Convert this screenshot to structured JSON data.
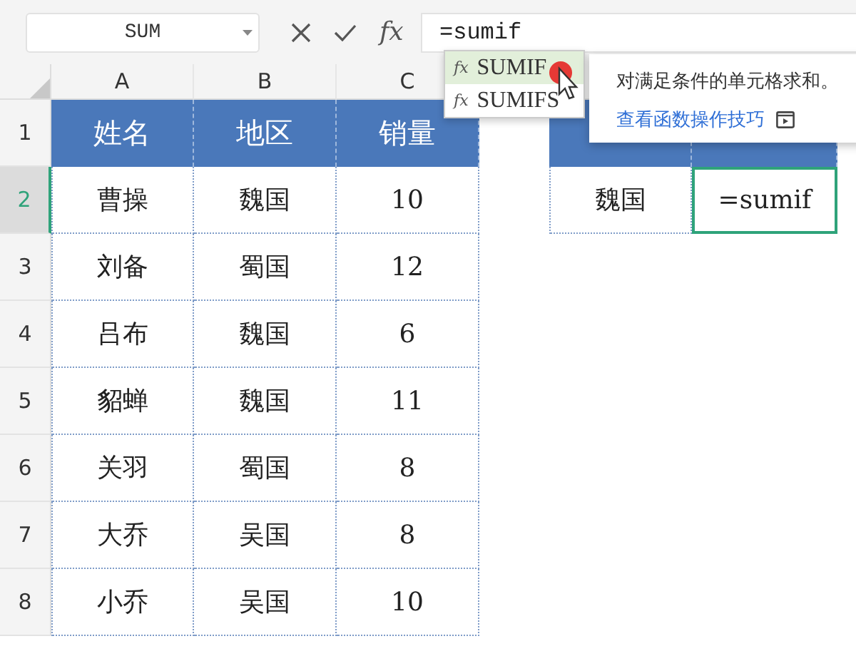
{
  "name_box": "SUM",
  "fx_label": "fx",
  "formula": "=sumif",
  "columns": [
    "A",
    "B",
    "C"
  ],
  "row_numbers": [
    {
      "label": "1",
      "selected": false
    },
    {
      "label": "2",
      "selected": true
    },
    {
      "label": "3",
      "selected": false
    },
    {
      "label": "4",
      "selected": false
    },
    {
      "label": "5",
      "selected": false
    },
    {
      "label": "6",
      "selected": false
    },
    {
      "label": "7",
      "selected": false
    },
    {
      "label": "8",
      "selected": false
    }
  ],
  "table": {
    "header": [
      "姓名",
      "地区",
      "销量"
    ],
    "rows": [
      [
        "曹操",
        "魏国",
        "10"
      ],
      [
        "刘备",
        "蜀国",
        "12"
      ],
      [
        "吕布",
        "魏国",
        "6"
      ],
      [
        "貂蝉",
        "魏国",
        "11"
      ],
      [
        "关羽",
        "蜀国",
        "8"
      ],
      [
        "大乔",
        "吴国",
        "8"
      ],
      [
        "小乔",
        "吴国",
        "10"
      ]
    ]
  },
  "lookup": {
    "region": "魏国",
    "formula_cell": "=sumif",
    "selected": true
  },
  "autocomplete": [
    {
      "icon_text": "fx",
      "name": "SUMIF",
      "selected": true
    },
    {
      "icon_text": "fx",
      "name": "SUMIFS",
      "selected": false
    }
  ],
  "tooltip": {
    "description": "对满足条件的单元格求和。",
    "link": "查看函数操作技巧"
  }
}
